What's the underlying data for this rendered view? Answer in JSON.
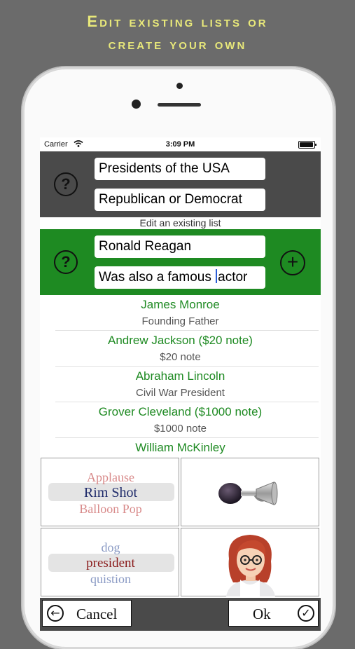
{
  "promo": {
    "line1": "Edit existing lists or",
    "line2": "create your own"
  },
  "status_bar": {
    "carrier": "Carrier",
    "time": "3:09 PM",
    "wifi_icon": "wifi-icon",
    "battery_icon": "battery-icon"
  },
  "list_header": {
    "help_label": "?",
    "title_value": "Presidents of the USA",
    "subtitle_value": "Republican or Democrat"
  },
  "caption": "Edit an existing list",
  "item_editor": {
    "help_label": "?",
    "name_value": "Ronald Reagan",
    "hint_before_cursor": "Was also a famous ",
    "hint_after_cursor": "actor",
    "add_label": "+"
  },
  "items": [
    {
      "name": "James Monroe",
      "desc": "Founding Father"
    },
    {
      "name": "Andrew Jackson ($20 note)",
      "desc": "$20 note"
    },
    {
      "name": "Abraham Lincoln",
      "desc": "Civil War President"
    },
    {
      "name": "Grover Cleveland ($1000 note)",
      "desc": "$1000 note"
    },
    {
      "name": "William McKinley",
      "desc": ""
    }
  ],
  "sound_picker": {
    "options": [
      "Applause",
      "Rim Shot",
      "Balloon Pop"
    ],
    "selected": "Rim Shot"
  },
  "voice_picker": {
    "options": [
      "dog",
      "president",
      "quistion"
    ],
    "selected": "president"
  },
  "icons": {
    "horn": "bicycle-horn-icon",
    "avatar": "woman-with-glasses-avatar"
  },
  "buttons": {
    "cancel_label": "Cancel",
    "cancel_icon": "arrow-left-icon",
    "ok_label": "Ok",
    "ok_icon": "checkmark-icon"
  },
  "colors": {
    "background": "#6b6b6b",
    "promo_text": "#e8e87a",
    "header_panel": "#4a4a4a",
    "editor_panel": "#1e8a22",
    "list_name": "#1e8a22"
  }
}
